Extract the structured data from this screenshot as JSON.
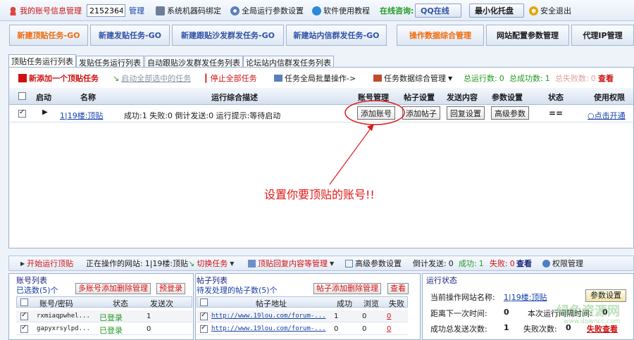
{
  "toolbar": {
    "account_info": "我的账号信息管理",
    "account_id": "21523644",
    "manage": "管理",
    "bind_machine": "系统机器码绑定",
    "global_params": "全局运行参数设置",
    "tutorial": "软件使用教程",
    "online_consult": "在线咨询:",
    "qq_online": "QQ在线",
    "minimize_tray": "最小化托盘",
    "safe_exit": "安全退出"
  },
  "task_buttons": {
    "new_top": "新建顶贴任务-GO",
    "new_post": "新建发贴任务-GO",
    "new_follow": "新建跟贴沙发群发任务-GO",
    "new_pm": "新建站内信群发任务-GO",
    "data_mgmt": "操作数据综合管理",
    "site_config": "网站配置参数管理",
    "proxy_ip": "代理IP管理"
  },
  "tabs": [
    "顶贴任务运行列表",
    "发贴任务运行列表",
    "自动跟贴沙发群发任务列表",
    "论坛站内信群发任务列表"
  ],
  "actions": {
    "new_add": "新添加一个顶贴任务",
    "start_all": "启动全部选中的任务",
    "stop_all": "停止全部任务",
    "global_batch": "任务全局批量操作->",
    "data_mgmt": "任务数据综合管理",
    "total_label": "总运行数:",
    "total_value": "0",
    "success_label": "总成功数:",
    "success_value": "1",
    "fail_label": "总失败数:",
    "fail_value": "0",
    "view": "查看"
  },
  "grid": {
    "headers": [
      "启动",
      "名称",
      "运行综合描述",
      "账号管理",
      "帖子设置",
      "发送内容",
      "参数设置",
      "状态",
      "使用权限"
    ],
    "row": {
      "name": "1|19楼:顶贴",
      "description": "成功:1  失败:0  倒计发送:0  运行提示:等待启动",
      "add_account": "添加账号",
      "add_post": "添加帖子",
      "reply_settings": "回复设置",
      "advanced_params": "高级参数",
      "status": "==",
      "permission": "○点击开通"
    }
  },
  "annotation": "设置你要顶贴的账号!!",
  "bottom_bar": {
    "start_run": "开始运行顶贴",
    "current_site_label": "正在操作的网站:",
    "current_site": "1|19楼:顶贴",
    "switch_task": "切换任务",
    "reply_content_mgmt": "顶贴回复内容等管理",
    "advanced_params": "高级参数设置",
    "countdown_label": "倒计发送:",
    "countdown_value": "0",
    "success_label": "成功:",
    "success_value": "1",
    "fail_label": "失败:",
    "fail_value": "0",
    "view": "查看",
    "permission_mgmt": "权限管理"
  },
  "account_panel": {
    "title": "账号列表",
    "selected": "已选数(5)个",
    "multi_manage": "多账号添加删除管理",
    "pre_login": "预登录",
    "headers": [
      "账号/密码",
      "状态",
      "发送次"
    ],
    "rows": [
      {
        "account": "rxmiaqpwhel...",
        "status": "已登录",
        "count": "1"
      },
      {
        "account": "gapyxrsylpd...",
        "status": "已登录",
        "count": "0"
      }
    ]
  },
  "post_panel": {
    "title": "帖子列表",
    "pending": "待发处理的帖子数(5)个",
    "add_delete": "帖子添加删除管理",
    "view": "查看",
    "headers": [
      "帖子地址",
      "成功",
      "浏览",
      "失败"
    ],
    "rows": [
      {
        "url": "http://www.19lou.com/forum-...",
        "success": "1",
        "views": "0",
        "fail": "0"
      },
      {
        "url": "http://www.19lou.com/forum-...",
        "success": "0",
        "views": "0",
        "fail": "0"
      }
    ]
  },
  "status_panel": {
    "title": "运行状态",
    "current_site_label": "当前操作网站名称:",
    "current_site": "1|19楼:顶贴",
    "param_settings": "参数设置",
    "next_time_label": "距离下一次时间:",
    "next_time_value": "0",
    "interval_label": "本次运行间隔时间:",
    "interval_value": "0",
    "success_total_label": "成功总发送次数:",
    "success_total_value": "1",
    "fail_total_label": "失败次数:",
    "fail_total_value": "0",
    "fail_view": "失败查看"
  },
  "watermark": "绿色资源网",
  "watermark_url": "www.downcc.com"
}
